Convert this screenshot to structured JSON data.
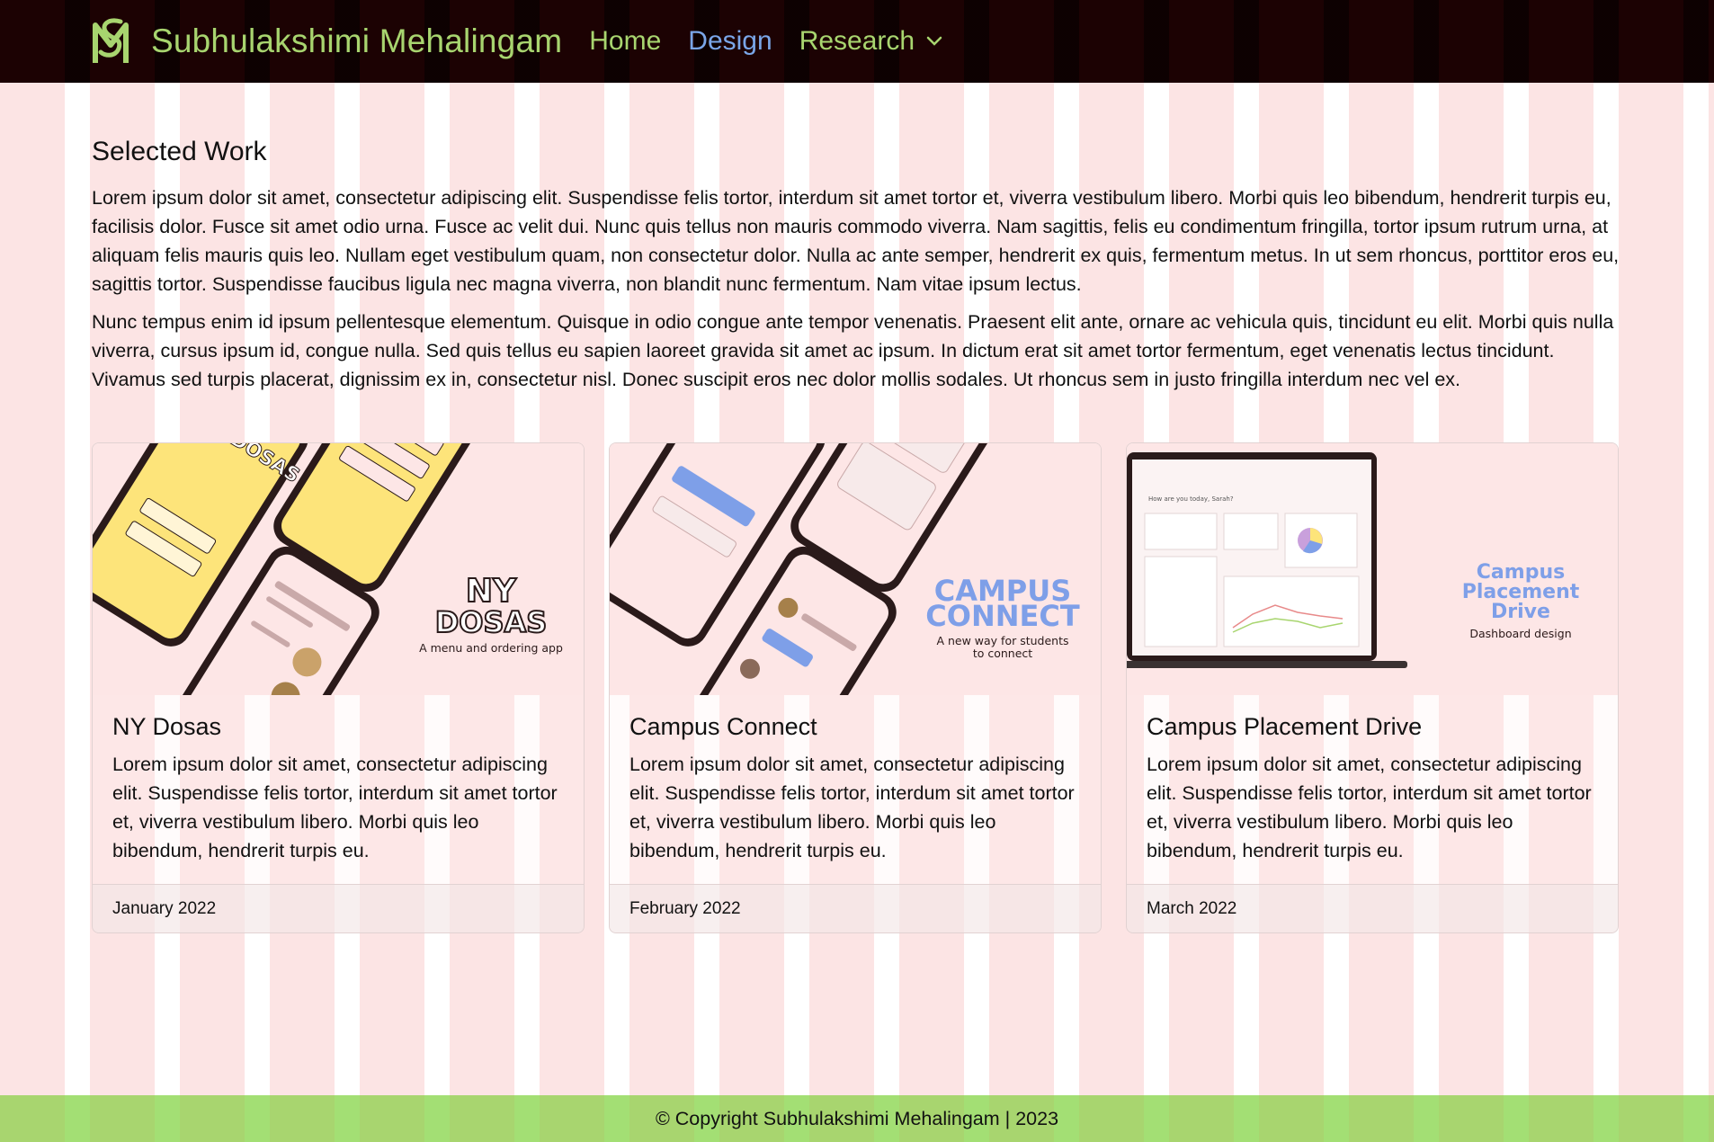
{
  "header": {
    "brand_name": "Subhulakshimi Mehalingam",
    "nav": [
      {
        "label": "Home"
      },
      {
        "label": "Design"
      },
      {
        "label": "Research"
      }
    ]
  },
  "colors": {
    "nav_bg": "#1c0203",
    "brand_green": "#a8d56f",
    "active_link": "#7aa6e8",
    "page_bg": "#fce4e4"
  },
  "main": {
    "title": "Selected Work",
    "paragraphs": [
      "Lorem ipsum dolor sit amet, consectetur adipiscing elit. Suspendisse felis tortor, interdum sit amet tortor et, viverra vestibulum libero. Morbi quis leo bibendum, hendrerit turpis eu, facilisis dolor. Fusce sit amet odio urna. Fusce ac velit dui. Nunc quis tellus non mauris commodo viverra. Nam sagittis, felis eu condimentum fringilla, tortor ipsum rutrum urna, at aliquam felis mauris quis leo. Nullam eget vestibulum quam, non consectetur dolor. Nulla ac ante semper, hendrerit ex quis, fermentum metus. In ut sem rhoncus, porttitor eros eu, sagittis tortor. Suspendisse faucibus ligula nec magna viverra, non blandit nunc fermentum. Nam vitae ipsum lectus.",
      "Nunc tempus enim id ipsum pellentesque elementum. Quisque in odio congue ante tempor venenatis. Praesent elit ante, ornare ac vehicula quis, tincidunt eu elit. Morbi quis nulla viverra, cursus ipsum id, congue nulla. Sed quis tellus eu sapien laoreet gravida sit amet ac ipsum. In dictum erat sit amet tortor fermentum, eget venenatis lectus tincidunt. Vivamus sed turpis placerat, dignissim ex in, consectetur nisl. Donec suscipit eros nec dolor mollis sodales. Ut rhoncus sem in justo fringilla interdum nec vel ex."
    ],
    "cards": [
      {
        "title": "NY Dosas",
        "text": "Lorem ipsum dolor sit amet, consectetur adipiscing elit. Suspendisse felis tortor, interdum sit amet tortor et, viverra vestibulum libero. Morbi quis leo bibendum, hendrerit turpis eu.",
        "date": "January 2022",
        "thumb": {
          "line1": "NY",
          "line2": "DOSAS",
          "caption": "A menu and ordering app",
          "screen_text": "NY DOSAS"
        }
      },
      {
        "title": "Campus Connect",
        "text": "Lorem ipsum dolor sit amet, consectetur adipiscing elit. Suspendisse felis tortor, interdum sit amet tortor et, viverra vestibulum libero. Morbi quis leo bibendum, hendrerit turpis eu.",
        "date": "February 2022",
        "thumb": {
          "line1": "CAMPUS",
          "line2": "CONNECT",
          "caption1": "A new way for students",
          "caption2": "to connect"
        }
      },
      {
        "title": "Campus Placement Drive",
        "text": "Lorem ipsum dolor sit amet, consectetur adipiscing elit. Suspendisse felis tortor, interdum sit amet tortor et, viverra vestibulum libero. Morbi quis leo bibendum, hendrerit turpis eu.",
        "date": "March 2022",
        "thumb": {
          "line1": "Campus",
          "line2": "Placement",
          "line3": "Drive",
          "caption": "Dashboard design",
          "screen_text": "How are you today, Sarah?"
        }
      }
    ]
  },
  "footer": {
    "text": "© Copyright Subhulakshimi Mehalingam | 2023"
  }
}
